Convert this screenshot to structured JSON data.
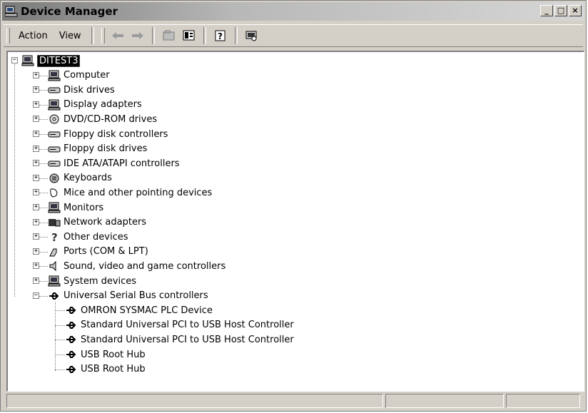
{
  "window": {
    "title": "Device Manager",
    "controls": {
      "minimize": "_",
      "maximize": "□",
      "close": "×"
    }
  },
  "menu": {
    "action": "Action",
    "view": "View"
  },
  "toolbar": {
    "buttons": [
      "back-icon",
      "forward-icon",
      "up-folder-icon",
      "properties-view-icon",
      "help-icon",
      "scan-hardware-icon"
    ]
  },
  "tree": {
    "root": "DITEST3",
    "categories": [
      {
        "label": "Computer",
        "icon": "computer-icon"
      },
      {
        "label": "Disk drives",
        "icon": "disk-drive-icon"
      },
      {
        "label": "Display adapters",
        "icon": "display-adapter-icon"
      },
      {
        "label": "DVD/CD-ROM drives",
        "icon": "cdrom-icon"
      },
      {
        "label": "Floppy disk controllers",
        "icon": "floppy-controller-icon"
      },
      {
        "label": "Floppy disk drives",
        "icon": "floppy-drive-icon"
      },
      {
        "label": "IDE ATA/ATAPI controllers",
        "icon": "ide-controller-icon"
      },
      {
        "label": "Keyboards",
        "icon": "keyboard-icon"
      },
      {
        "label": "Mice and other pointing devices",
        "icon": "mouse-icon"
      },
      {
        "label": "Monitors",
        "icon": "monitor-icon"
      },
      {
        "label": "Network adapters",
        "icon": "network-adapter-icon"
      },
      {
        "label": "Other devices",
        "icon": "unknown-device-icon"
      },
      {
        "label": "Ports (COM & LPT)",
        "icon": "port-icon"
      },
      {
        "label": "Sound, video and game controllers",
        "icon": "sound-icon"
      },
      {
        "label": "System devices",
        "icon": "system-device-icon"
      },
      {
        "label": "Universal Serial Bus controllers",
        "icon": "usb-icon"
      }
    ],
    "usb_children": [
      "OMRON SYSMAC PLC Device",
      "Standard Universal PCI to USB Host Controller",
      "Standard Universal PCI to USB Host Controller",
      "USB Root Hub",
      "USB Root Hub"
    ],
    "expander_collapsed": "+",
    "expander_expanded": "−"
  },
  "status": {
    "pane1": "",
    "pane2": "",
    "pane3": ""
  }
}
